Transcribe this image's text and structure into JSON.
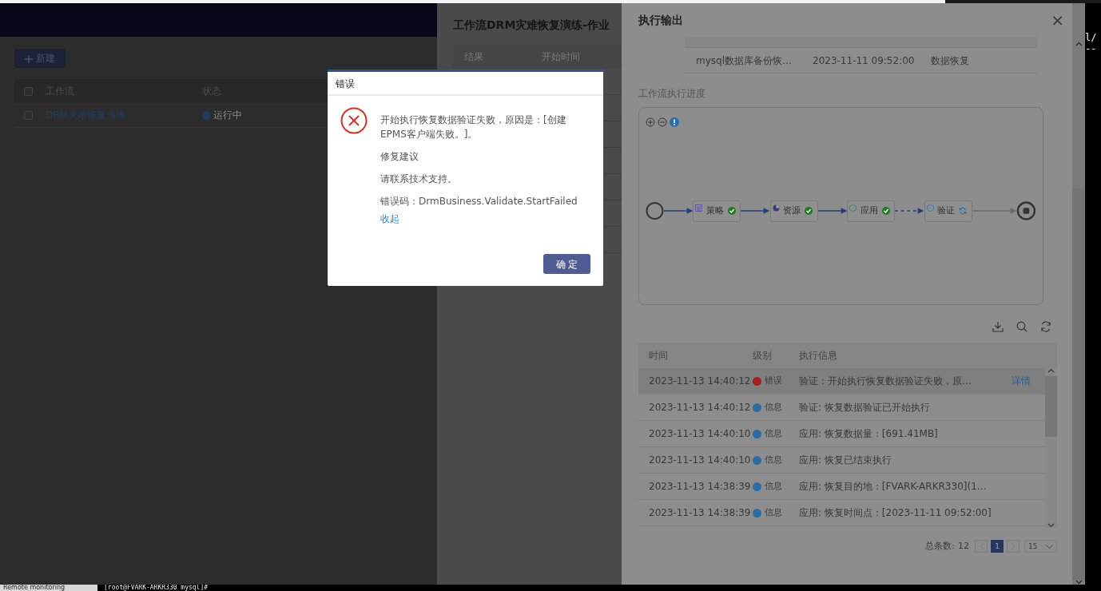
{
  "workflow_page": {
    "new_button": "新建",
    "select_all_checked": false,
    "columns": [
      "工作流",
      "状态"
    ],
    "rows": [
      {
        "name": "DRM灾难恢复演练",
        "status": "运行中",
        "checked": false
      }
    ]
  },
  "job_panel": {
    "title": "工作流DRM灾难恢复演练-作业",
    "columns": [
      "结果",
      "开始时间"
    ]
  },
  "output_panel": {
    "title": "执行输出",
    "close": "×",
    "task_row": [
      "mysql数据库备份恢…",
      "2023-11-11 09:52:00",
      "数据恢复"
    ],
    "progress_label": "工作流执行进度",
    "flow": {
      "nodes": [
        {
          "label": "策略",
          "kind": "policy",
          "done": true
        },
        {
          "label": "资源",
          "kind": "resource",
          "done": true
        },
        {
          "label": "应用",
          "kind": "app",
          "done": true
        },
        {
          "label": "验证",
          "kind": "verify",
          "done": false
        }
      ],
      "edges": [
        {
          "kind": "solid"
        },
        {
          "kind": "solid"
        },
        {
          "kind": "solid"
        },
        {
          "kind": "dashed"
        },
        {
          "kind": "pending"
        }
      ]
    },
    "log_table": {
      "columns": [
        "时间",
        "级别",
        "执行信息"
      ],
      "rows": [
        {
          "time": "2023-11-13 14:40:12",
          "level": "错误",
          "color": "#a3221d",
          "message": "验证：开始执行恢复数据验证失败，原…",
          "link": "详情",
          "selected": true
        },
        {
          "time": "2023-11-13 14:40:12",
          "level": "信息",
          "color": "#2b6ca6",
          "message": "验证: 恢复数据验证已开始执行",
          "selected": false
        },
        {
          "time": "2023-11-13 14:40:10",
          "level": "信息",
          "color": "#2b6ca6",
          "message": "应用: 恢复数据量：[691.41MB]",
          "selected": false
        },
        {
          "time": "2023-11-13 14:40:10",
          "level": "信息",
          "color": "#2b6ca6",
          "message": "应用: 恢复已结束执行",
          "selected": false
        },
        {
          "time": "2023-11-13 14:38:39",
          "level": "信息",
          "color": "#2b6ca6",
          "message": "应用: 恢复目的地：[FVARK-ARKR330](1…",
          "selected": false
        },
        {
          "time": "2023-11-13 14:38:39",
          "level": "信息",
          "color": "#2b6ca6",
          "message": "应用: 恢复时间点：[2023-11-11 09:52:00]",
          "selected": false
        }
      ]
    },
    "pagination": {
      "total_label": "总条数:",
      "total": "12",
      "pages": [
        {
          "label": "1",
          "selected": true
        }
      ],
      "page_size": "15"
    }
  },
  "error_dialog": {
    "title": "错误",
    "message": "开始执行恢复数据验证失败，原因是：[创建EPMS客户端失败。]。",
    "suggestion_label": "修复建议",
    "suggestion": "请联系技术支持。",
    "code": "错误码：DrmBusiness.Validate.StartFailed",
    "collapse_link": "收起",
    "ok_button": "确 定"
  },
  "terminal": {
    "side_lines": [
      "l/",
      "--"
    ],
    "taskbar_label": "Remote monitoring",
    "prompt": "[root@FVARK-ARKR330 mysql]#"
  }
}
